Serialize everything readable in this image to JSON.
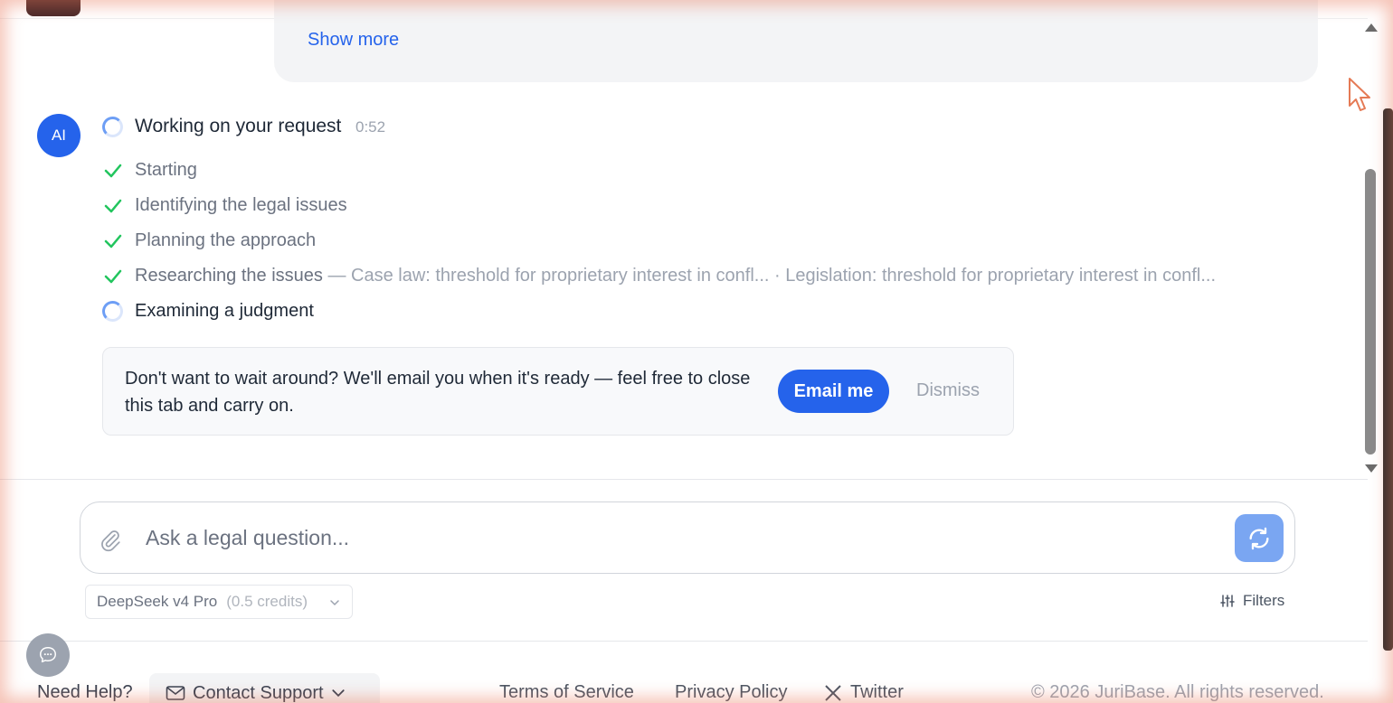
{
  "message": {
    "show_more": "Show more"
  },
  "assistant": {
    "avatar_label": "AI",
    "working_title": "Working on your request",
    "timer": "0:52",
    "steps": [
      {
        "label": "Starting",
        "status": "done"
      },
      {
        "label": "Identifying the legal issues",
        "status": "done"
      },
      {
        "label": "Planning the approach",
        "status": "done"
      },
      {
        "label": "Researching the issues",
        "status": "done",
        "detail": " — Case law: threshold for proprietary interest in confl... · Legislation: threshold for proprietary interest in confl..."
      },
      {
        "label": "Examining a judgment",
        "status": "in-progress"
      }
    ]
  },
  "notice": {
    "text": "Don't want to wait around? We'll email you when it's ready — feel free to close this tab and carry on.",
    "email_button": "Email me",
    "dismiss": "Dismiss"
  },
  "composer": {
    "placeholder": "Ask a legal question...",
    "model_name": "DeepSeek v4 Pro",
    "model_credits": "(0.5 credits)",
    "filters_label": "Filters"
  },
  "footer": {
    "help_label": "Need Help?",
    "contact_label": "Contact Support",
    "links": [
      "Terms of Service",
      "Privacy Policy",
      "Twitter"
    ],
    "copyright": "© 2026 JuriBase. All rights reserved."
  },
  "colors": {
    "accent": "#2563eb",
    "check": "#22c55e",
    "muted": "#9ca3af"
  }
}
